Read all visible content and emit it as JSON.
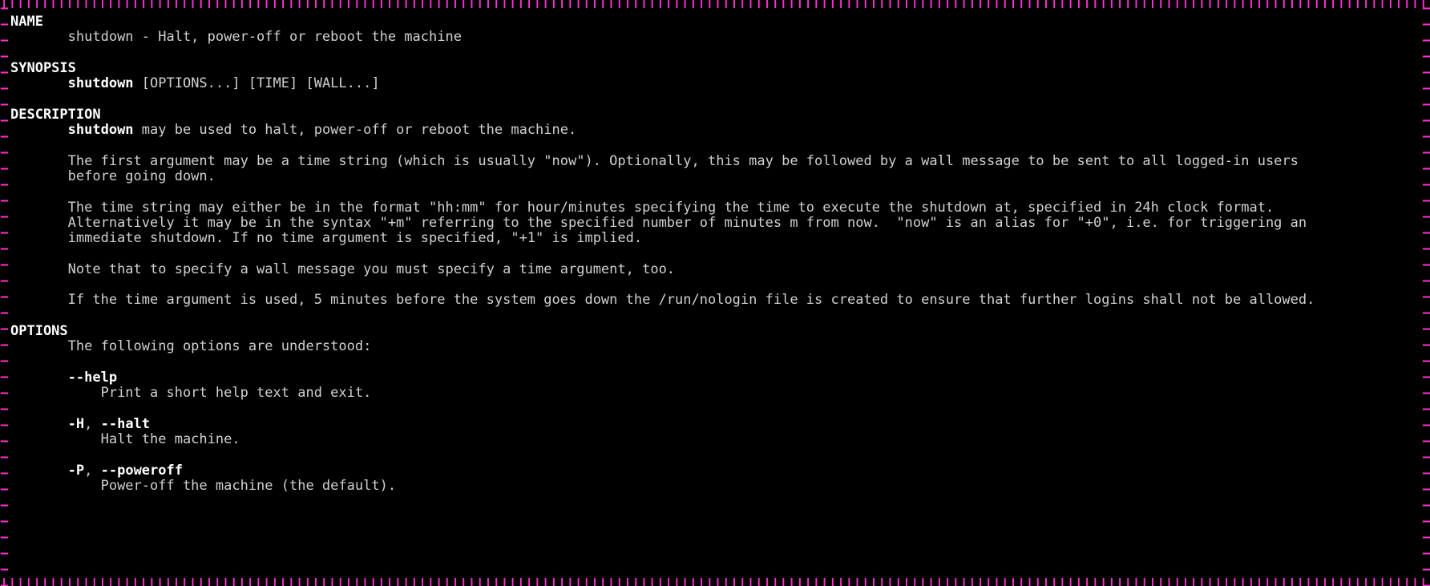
{
  "sections": {
    "name": {
      "header": "NAME",
      "line": "shutdown - Halt, power-off or reboot the machine"
    },
    "synopsis": {
      "header": "SYNOPSIS",
      "cmd": "shutdown",
      "args": " [OPTIONS...] [TIME] [WALL...]"
    },
    "description": {
      "header": "DESCRIPTION",
      "cmd": "shutdown",
      "line1": " may be used to halt, power-off or reboot the machine.",
      "para2a": "The first argument may be a time string (which is usually \"now\"). Optionally, this may be followed by a wall message to be sent to all logged-in users",
      "para2b": "before going down.",
      "para3a": "The time string may either be in the format \"hh:mm\" for hour/minutes specifying the time to execute the shutdown at, specified in 24h clock format.",
      "para3b": "Alternatively it may be in the syntax \"+m\" referring to the specified number of minutes m from now.  \"now\" is an alias for \"+0\", i.e. for triggering an",
      "para3c": "immediate shutdown. If no time argument is specified, \"+1\" is implied.",
      "para4": "Note that to specify a wall message you must specify a time argument, too.",
      "para5": "If the time argument is used, 5 minutes before the system goes down the /run/nologin file is created to ensure that further logins shall not be allowed."
    },
    "options": {
      "header": "OPTIONS",
      "intro": "The following options are understood:",
      "help_flag": "--help",
      "help_desc": "Print a short help text and exit.",
      "halt_short": "-H",
      "halt_sep": ", ",
      "halt_long": "--halt",
      "halt_desc": "Halt the machine.",
      "poweroff_short": "-P",
      "poweroff_sep": ", ",
      "poweroff_long": "--poweroff",
      "poweroff_desc": "Power-off the machine (the default)."
    }
  },
  "indent1": "       ",
  "indent2": "           "
}
